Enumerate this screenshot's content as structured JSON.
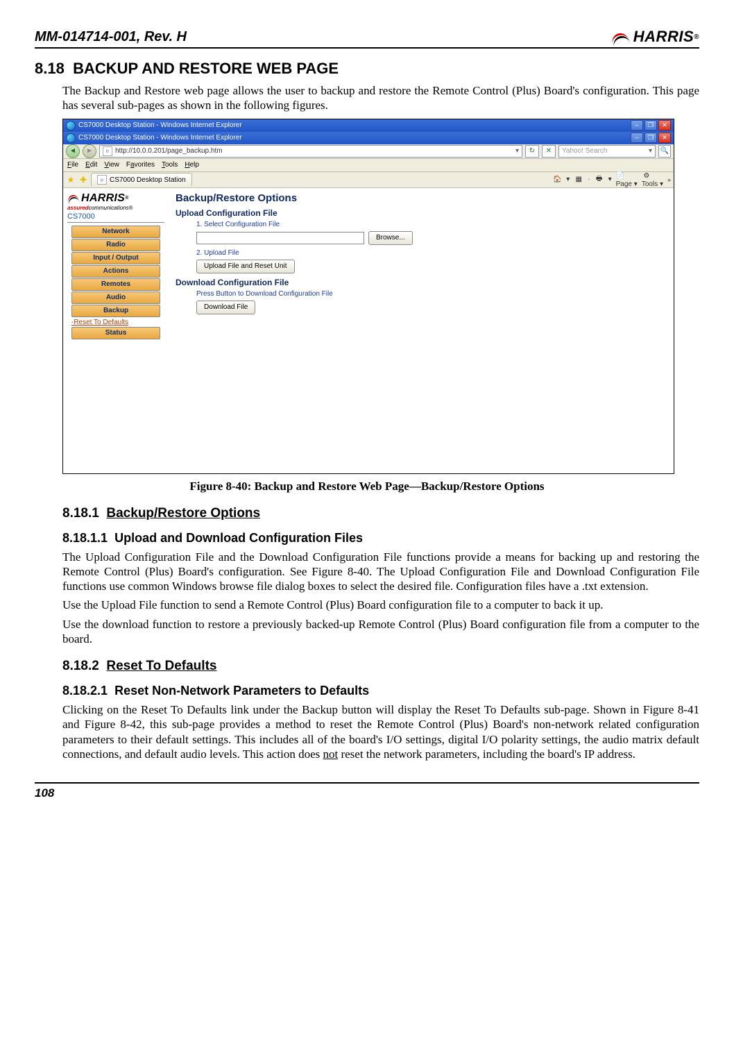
{
  "header": {
    "doc_id": "MM-014714-001, Rev. H",
    "logo_text": "HARRIS",
    "logo_mark": "®"
  },
  "section_818": {
    "number": "8.18",
    "title": "BACKUP AND RESTORE WEB PAGE",
    "intro": "The Backup and Restore web page allows the user to backup and restore the Remote Control (Plus) Board's configuration. This page has several sub-pages as shown in the following figures."
  },
  "figure_caption": "Figure 8-40:  Backup and Restore Web Page—Backup/Restore Options",
  "screenshot": {
    "titlebar1": "CS7000 Desktop Station - Windows Internet Explorer",
    "titlebar2": "CS7000 Desktop Station - Windows Internet Explorer",
    "url": "http://10.0.0.201/page_backup.htm",
    "search_placeholder": "Yahoo! Search",
    "menu": {
      "file": "File",
      "edit": "Edit",
      "view": "View",
      "favorites": "Favorites",
      "tools": "Tools",
      "help": "Help"
    },
    "tab_label": "CS7000 Desktop Station",
    "toolbar": {
      "page": "Page",
      "tools": "Tools"
    },
    "sidebar": {
      "logo_main": "HARRIS",
      "logo_mark": "®",
      "tagline_red": "assured",
      "tagline_blk": "communications®",
      "model": "CS7000",
      "items": [
        "Network",
        "Radio",
        "Input / Output",
        "Actions",
        "Remotes",
        "Audio",
        "Backup"
      ],
      "link_reset": "-Reset To Defaults",
      "status": "Status"
    },
    "main": {
      "title": "Backup/Restore Options",
      "upload_heading": "Upload Configuration File",
      "step1": "1. Select Configuration File",
      "browse_btn": "Browse...",
      "step2": "2. Upload File",
      "upload_btn": "Upload File and Reset Unit",
      "download_heading": "Download Configuration File",
      "download_note": "Press Button to Download Configuration File",
      "download_btn": "Download File"
    }
  },
  "s8181": {
    "number": "8.18.1",
    "title": "Backup/Restore Options"
  },
  "s81811": {
    "number": "8.18.1.1",
    "title": "Upload and Download Configuration Files",
    "p1": "The Upload Configuration File and the Download Configuration File functions provide a means for backing up and restoring the Remote Control (Plus) Board's configuration. See Figure 8-40. The Upload Configuration File and Download Configuration File functions use common Windows browse file dialog boxes to select the desired file.  Configuration files have a .txt extension.",
    "p2": "Use the Upload File function to send a Remote Control (Plus) Board configuration file to a computer to back it up.",
    "p3": "Use the download function to restore a previously backed-up Remote Control (Plus) Board configuration file from a computer to the board."
  },
  "s8182": {
    "number": "8.18.2",
    "title": "Reset To Defaults"
  },
  "s81821": {
    "number": "8.18.2.1",
    "title": "Reset Non-Network Parameters to Defaults",
    "p1_a": "Clicking on the Reset To Defaults link under the Backup button will display the Reset To Defaults sub-page. Shown in Figure 8-41 and Figure 8-42, this sub-page provides a method to reset the Remote Control (Plus) Board's non-network related configuration parameters to their default settings. This includes all of the board's I/O settings, digital I/O polarity settings, the audio matrix default connections, and default audio levels. This action does ",
    "p1_not": "not",
    "p1_b": " reset the network parameters, including the board's IP address."
  },
  "footer": {
    "page_num": "108"
  }
}
